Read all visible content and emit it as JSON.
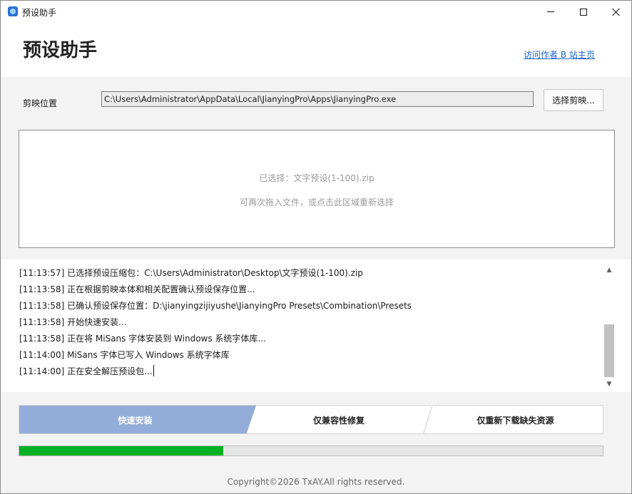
{
  "window": {
    "title": "预设助手",
    "controls": {
      "minimize": "minimize",
      "maximize": "maximize",
      "close": "close"
    }
  },
  "header": {
    "title": "预设助手",
    "author_link": "访问作者 B 站主页"
  },
  "path": {
    "label": "剪映位置",
    "value": "C:\\Users\\Administrator\\AppData\\Local\\JianyingPro\\Apps\\JianyingPro.exe",
    "choose_button": "选择剪映..."
  },
  "dropzone": {
    "selected": "已选择：文字预设(1-100).zip",
    "hint": "可再次拖入文件，或点击此区域重新选择"
  },
  "log": {
    "lines": [
      "[11:13:57] 已选择预设压缩包：C:\\Users\\Administrator\\Desktop\\文字预设(1-100).zip",
      "[11:13:58] 正在根据剪映本体和相关配置确认预设保存位置...",
      "[11:13:58] 已确认预设保存位置：D:\\jianyingzijiyushe\\JianyingPro Presets\\Combination\\Presets",
      "[11:13:58] 开始快速安装...",
      "[11:13:58] 正在将 MiSans 字体安装到 Windows 系统字体库...",
      "[11:14:00] MiSans 字体已写入 Windows 系统字体库",
      "[11:14:00] 正在安全解压预设包..."
    ],
    "scrollbar": {
      "up_icon": "▲",
      "down_icon": "▼"
    }
  },
  "modes": {
    "items": [
      "快速安装",
      "仅兼容性修复",
      "仅重新下载缺失资源"
    ],
    "active": 0,
    "active_color": "#94acd9"
  },
  "progress": {
    "value_fraction": 0.35,
    "color": "#06b025"
  },
  "footer": {
    "copyright": "Copyright©2026 TxAY.All rights reserved."
  }
}
